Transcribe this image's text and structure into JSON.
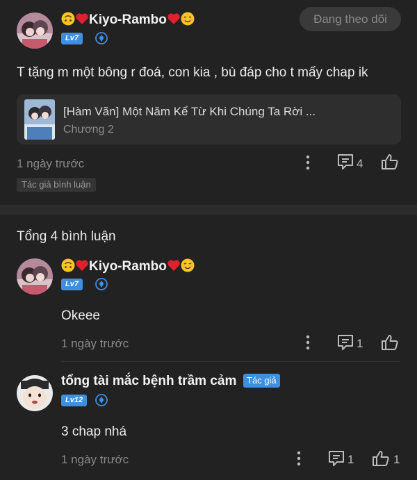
{
  "post": {
    "username": "Kiyo-Rambo",
    "level": "Lv7",
    "follow_label": "Đang theo dõi",
    "text": "T tặng m một bông r đoá, con kia , bù đáp cho t mấy chap ik",
    "card": {
      "title": "[Hàm Vãn] Một Năm Kể Từ Khi Chúng Ta Rời ...",
      "subtitle": "Chương 2"
    },
    "time": "1 ngày trước",
    "reply_count": "4",
    "author_chip": "Tác giả bình luận"
  },
  "comments_section": {
    "title": "Tổng 4 bình luận"
  },
  "comments": [
    {
      "username": "Kiyo-Rambo",
      "level": "Lv7",
      "text": "Okeee",
      "time": "1 ngày trước",
      "reply_count": "1",
      "like_count": ""
    },
    {
      "username": "tổng tài mắc bệnh trầm cảm",
      "author_tag": "Tác giả",
      "level": "Lv12",
      "text": "3 chap nhá",
      "time": "1 ngày trước",
      "reply_count": "1",
      "like_count": "1"
    }
  ],
  "colors": {
    "accent": "#3d8fe0",
    "background": "#222222",
    "card": "#2e2e2e",
    "muted": "#8a8a8a"
  },
  "icons": [
    "more-vertical-icon",
    "comment-icon",
    "thumbs-up-icon",
    "vip-diamond-icon",
    "heart-emoji",
    "upside-down-face-emoji",
    "smiling-face-emoji"
  ]
}
